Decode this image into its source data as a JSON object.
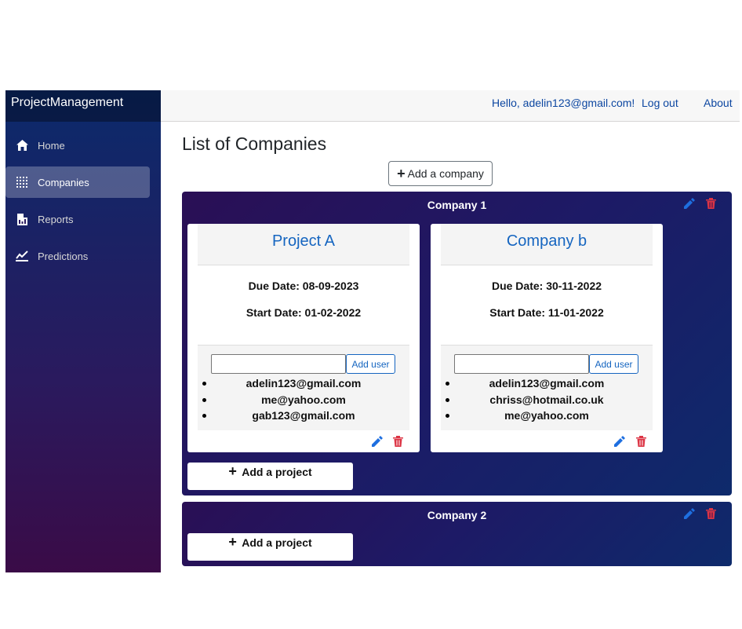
{
  "brand": "ProjectManagement",
  "nav": [
    {
      "label": "Home",
      "icon": "home-icon"
    },
    {
      "label": "Companies",
      "icon": "grid-icon",
      "active": true
    },
    {
      "label": "Reports",
      "icon": "report-icon"
    },
    {
      "label": "Predictions",
      "icon": "chart-line-icon"
    }
  ],
  "topbar": {
    "greeting": "Hello, adelin123@gmail.com!",
    "logout": "Log out",
    "about": "About"
  },
  "page_title": "List of Companies",
  "add_company_label": "Add a company",
  "companies": [
    {
      "name": "Company 1",
      "projects": [
        {
          "title": "Project A",
          "due": "Due Date: 08-09-2023",
          "start": "Start Date: 01-02-2022",
          "add_user_label": "Add user",
          "users": [
            "adelin123@gmail.com",
            "me@yahoo.com",
            "gab123@gmail.com"
          ]
        },
        {
          "title": "Company b",
          "due": "Due Date: 30-11-2022",
          "start": "Start Date: 11-01-2022",
          "add_user_label": "Add user",
          "users": [
            "adelin123@gmail.com",
            "chriss@hotmail.co.uk",
            "me@yahoo.com"
          ]
        }
      ],
      "add_project_label": "Add a project"
    },
    {
      "name": "Company 2",
      "projects": [],
      "add_project_label": "Add a project"
    }
  ],
  "colors": {
    "edit": "#1e6fe0",
    "delete": "#dc3545",
    "link": "#0d47a1"
  }
}
